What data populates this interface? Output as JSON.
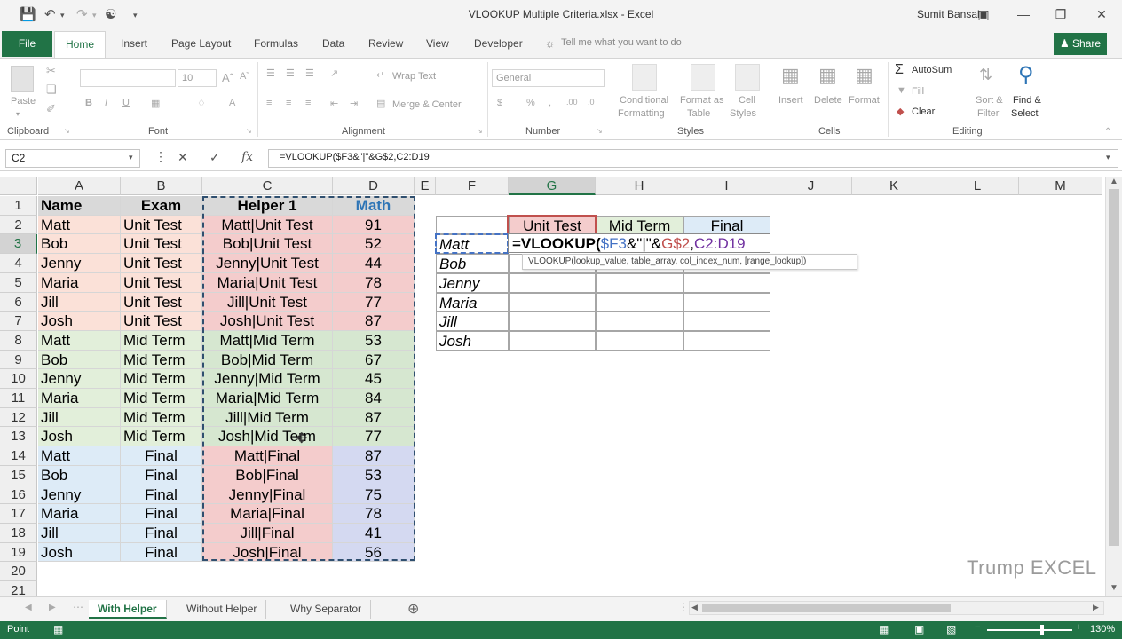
{
  "window": {
    "title": "VLOOKUP Multiple Criteria.xlsx - Excel",
    "user": "Sumit Bansal"
  },
  "ribbon_tabs": {
    "file": "File",
    "home": "Home",
    "insert": "Insert",
    "page_layout": "Page Layout",
    "formulas": "Formulas",
    "data": "Data",
    "review": "Review",
    "view": "View",
    "developer": "Developer",
    "tell_me": "Tell me what you want to do",
    "share": "Share"
  },
  "ribbon": {
    "clipboard": {
      "label": "Clipboard",
      "paste": "Paste"
    },
    "font": {
      "label": "Font",
      "size": "10"
    },
    "alignment": {
      "label": "Alignment",
      "wrap_text": "Wrap Text",
      "merge_center": "Merge & Center"
    },
    "number": {
      "label": "Number",
      "format": "General"
    },
    "styles": {
      "label": "Styles",
      "conditional_formatting_1": "Conditional",
      "conditional_formatting_2": "Formatting",
      "format_as_table_1": "Format as",
      "format_as_table_2": "Table",
      "cell_styles_1": "Cell",
      "cell_styles_2": "Styles"
    },
    "cells": {
      "label": "Cells",
      "insert": "Insert",
      "delete": "Delete",
      "format": "Format"
    },
    "editing": {
      "label": "Editing",
      "autosum": "AutoSum",
      "fill": "Fill",
      "clear": "Clear",
      "sort_filter_1": "Sort &",
      "sort_filter_2": "Filter",
      "find_select_1": "Find &",
      "find_select_2": "Select"
    }
  },
  "formula_bar": {
    "name_box": "C2",
    "formula": "=VLOOKUP($F3&\"|\"&G$2,C2:D19"
  },
  "columns": [
    "A",
    "B",
    "C",
    "D",
    "E",
    "F",
    "G",
    "H",
    "I",
    "J",
    "K",
    "L",
    "M"
  ],
  "rows": [
    "1",
    "2",
    "3",
    "4",
    "5",
    "6",
    "7",
    "8",
    "9",
    "10",
    "11",
    "12",
    "13",
    "14",
    "15",
    "16",
    "17",
    "18",
    "19",
    "20",
    "21"
  ],
  "table": {
    "headers": {
      "name": "Name",
      "exam": "Exam",
      "helper": "Helper 1",
      "math": "Math"
    },
    "rows": [
      {
        "name": "Matt",
        "exam": "Unit Test",
        "helper": "Matt|Unit Test",
        "math": "91"
      },
      {
        "name": "Bob",
        "exam": "Unit Test",
        "helper": "Bob|Unit Test",
        "math": "52"
      },
      {
        "name": "Jenny",
        "exam": "Unit Test",
        "helper": "Jenny|Unit Test",
        "math": "44"
      },
      {
        "name": "Maria",
        "exam": "Unit Test",
        "helper": "Maria|Unit Test",
        "math": "78"
      },
      {
        "name": "Jill",
        "exam": "Unit Test",
        "helper": "Jill|Unit Test",
        "math": "77"
      },
      {
        "name": "Josh",
        "exam": "Unit Test",
        "helper": "Josh|Unit Test",
        "math": "87"
      },
      {
        "name": "Matt",
        "exam": "Mid Term",
        "helper": "Matt|Mid Term",
        "math": "53"
      },
      {
        "name": "Bob",
        "exam": "Mid Term",
        "helper": "Bob|Mid Term",
        "math": "67"
      },
      {
        "name": "Jenny",
        "exam": "Mid Term",
        "helper": "Jenny|Mid Term",
        "math": "45"
      },
      {
        "name": "Maria",
        "exam": "Mid Term",
        "helper": "Maria|Mid Term",
        "math": "84"
      },
      {
        "name": "Jill",
        "exam": "Mid Term",
        "helper": "Jill|Mid Term",
        "math": "87"
      },
      {
        "name": "Josh",
        "exam": "Mid Term",
        "helper": "Josh|Mid Term",
        "math": "77"
      },
      {
        "name": "Matt",
        "exam": "Final",
        "helper": "Matt|Final",
        "math": "87"
      },
      {
        "name": "Bob",
        "exam": "Final",
        "helper": "Bob|Final",
        "math": "53"
      },
      {
        "name": "Jenny",
        "exam": "Final",
        "helper": "Jenny|Final",
        "math": "75"
      },
      {
        "name": "Maria",
        "exam": "Final",
        "helper": "Maria|Final",
        "math": "78"
      },
      {
        "name": "Jill",
        "exam": "Final",
        "helper": "Jill|Final",
        "math": "41"
      },
      {
        "name": "Josh",
        "exam": "Final",
        "helper": "Josh|Final",
        "math": "56"
      }
    ]
  },
  "lookup": {
    "headers": [
      "Unit Test",
      "Mid Term",
      "Final"
    ],
    "names": [
      "Matt",
      "Bob",
      "Jenny",
      "Maria",
      "Jill",
      "Josh"
    ],
    "edit_formula": {
      "part1": "=VLOOKUP(",
      "part2": "$F3",
      "part3": "&\"|\"&",
      "part4": "G$2",
      "part5": ",",
      "part6": "C2:D19"
    },
    "tooltip": "VLOOKUP(lookup_value, table_array, col_index_num, [range_lookup])"
  },
  "watermark": "Trump EXCEL",
  "sheets": {
    "tabs": [
      "With Helper",
      "Without Helper",
      "Why Separator"
    ],
    "active_index": 0
  },
  "status": {
    "mode": "Point",
    "zoom": "130%"
  },
  "colors": {
    "accent": "#217346",
    "unit_test_fill": "#fbe1d8",
    "mid_term_fill": "#e2efda",
    "final_fill": "#ddebf7",
    "helper_fill": "#f4cccc",
    "ref_blue": "#4472c4",
    "ref_red": "#c0504d",
    "ref_purple": "#7030a0"
  }
}
